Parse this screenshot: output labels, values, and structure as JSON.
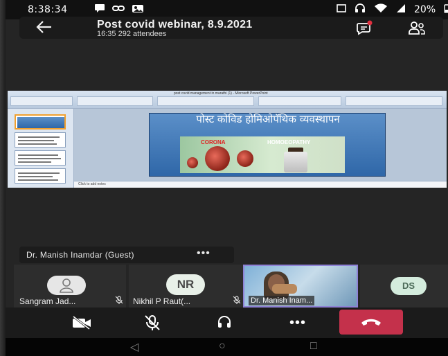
{
  "status_bar": {
    "time": "8:38:34",
    "battery": "20%",
    "icons": [
      "chat-bubble-icon",
      "link-icon",
      "gallery-icon",
      "cast-icon",
      "headset-icon",
      "wifi-icon",
      "signal-icon",
      "battery-icon"
    ]
  },
  "header": {
    "back_icon": "arrow-left-icon",
    "title": "Post covid webinar, 8.9.2021",
    "subtitle": "16:35  292 attendees",
    "chat_icon": "chat-icon",
    "participants_icon": "people-icon"
  },
  "shared_screen": {
    "app_title": "post covid management in marathi (1) - Microsoft PowerPoint",
    "slide_title": "पोस्ट कोविड होमिओपॅथिक व्यवस्थापन",
    "slide_image_label_left": "CORONA",
    "slide_image_label_right": "HOMOEOPATHY",
    "notes_placeholder": "Click to add notes"
  },
  "presenter": {
    "name": "Dr. Manish Inamdar (Guest)",
    "more": "•••"
  },
  "participants": [
    {
      "label": "Sangram Jad...",
      "avatar": "person-icon",
      "muted": true
    },
    {
      "label": "Nikhil P Raut(...",
      "initials": "NR",
      "muted": true
    },
    {
      "label": "Dr. Manish Inam...",
      "video": true
    },
    {
      "initials": "DS"
    }
  ],
  "controls": {
    "camera": "camera-off-icon",
    "mic": "mic-off-icon",
    "audio": "headset-icon",
    "more": "•••",
    "hangup": "phone-hangup-icon",
    "hangup_color": "#c4314b"
  },
  "navbar": {
    "back": "◁",
    "home": "○",
    "recents": "□"
  }
}
